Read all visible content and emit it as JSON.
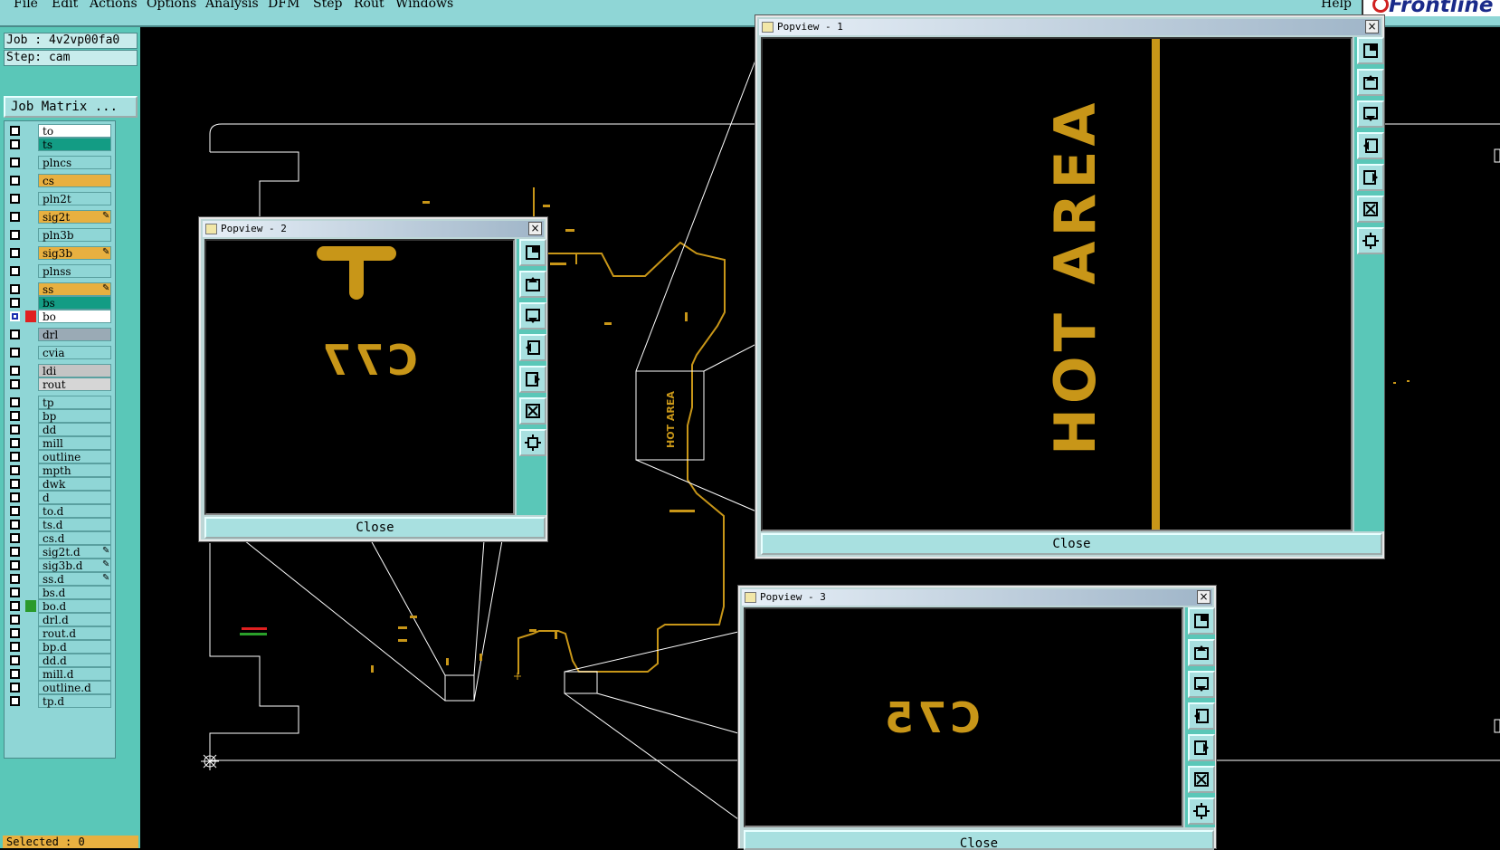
{
  "menubar": {
    "items": [
      "File",
      "Edit",
      "Actions",
      "Options",
      "Analysis",
      "DFM",
      "Step",
      "Rout",
      "Windows"
    ],
    "help": "Help",
    "brand": "Frontline"
  },
  "job": {
    "label": "Job : 4v2vp00fa0"
  },
  "step": {
    "label": "Step: cam"
  },
  "job_matrix_button": "Job Matrix ...",
  "layers": [
    {
      "name": "to",
      "color": "#ffffff"
    },
    {
      "name": "ts",
      "color": "#139c84"
    },
    {
      "name": "plncs",
      "color": "#8fd6d6"
    },
    {
      "name": "cs",
      "color": "#e8b040"
    },
    {
      "name": "pln2t",
      "color": "#8fd6d6"
    },
    {
      "name": "sig2t",
      "color": "#e8b040",
      "lock": true
    },
    {
      "name": "pln3b",
      "color": "#8fd6d6"
    },
    {
      "name": "sig3b",
      "color": "#e8b040",
      "lock": true
    },
    {
      "name": "plnss",
      "color": "#8fd6d6"
    },
    {
      "name": "ss",
      "color": "#e8b040",
      "lock": true
    },
    {
      "name": "bs",
      "color": "#139c84"
    },
    {
      "name": "bo",
      "color": "#ffffff",
      "checked": true,
      "swatch": "#e02020"
    },
    {
      "name": "drl",
      "color": "#9aaab5"
    },
    {
      "name": "cvia",
      "color": "#8fd6d6"
    },
    {
      "name": "ldi",
      "color": "#c4c4c4"
    },
    {
      "name": "rout",
      "color": "#d6d6d6"
    },
    {
      "name": "tp",
      "color": "#8fd6d6"
    },
    {
      "name": "bp",
      "color": "#8fd6d6"
    },
    {
      "name": "dd",
      "color": "#8fd6d6"
    },
    {
      "name": "mill",
      "color": "#8fd6d6"
    },
    {
      "name": "outline",
      "color": "#8fd6d6"
    },
    {
      "name": "mpth",
      "color": "#8fd6d6"
    },
    {
      "name": "dwk",
      "color": "#8fd6d6"
    },
    {
      "name": "d",
      "color": "#8fd6d6"
    },
    {
      "name": "to.d",
      "color": "#8fd6d6"
    },
    {
      "name": "ts.d",
      "color": "#8fd6d6"
    },
    {
      "name": "cs.d",
      "color": "#8fd6d6"
    },
    {
      "name": "sig2t.d",
      "color": "#8fd6d6",
      "lock": true
    },
    {
      "name": "sig3b.d",
      "color": "#8fd6d6",
      "lock": true
    },
    {
      "name": "ss.d",
      "color": "#8fd6d6",
      "lock": true
    },
    {
      "name": "bs.d",
      "color": "#8fd6d6"
    },
    {
      "name": "bo.d",
      "color": "#8fd6d6",
      "swatch": "#2a9a2a"
    },
    {
      "name": "drl.d",
      "color": "#8fd6d6"
    },
    {
      "name": "rout.d",
      "color": "#8fd6d6"
    },
    {
      "name": "bp.d",
      "color": "#8fd6d6"
    },
    {
      "name": "dd.d",
      "color": "#8fd6d6"
    },
    {
      "name": "mill.d",
      "color": "#8fd6d6"
    },
    {
      "name": "outline.d",
      "color": "#8fd6d6"
    },
    {
      "name": "tp.d",
      "color": "#8fd6d6"
    }
  ],
  "status": {
    "selected": "Selected : 0"
  },
  "popups": {
    "p1": {
      "title": "Popview - 1",
      "content": "HOT AREA",
      "close": "Close"
    },
    "p2": {
      "title": "Popview - 2",
      "content": "C77",
      "close": "Close"
    },
    "p3": {
      "title": "Popview - 3",
      "content": "C75",
      "close": "Close"
    }
  },
  "canvas_labels": {
    "hot_area": "HOT AREA"
  },
  "colors": {
    "trace": "#c89618",
    "panel": "#5ac7b8",
    "button": "#a8e0e0",
    "canvas": "#000000"
  }
}
